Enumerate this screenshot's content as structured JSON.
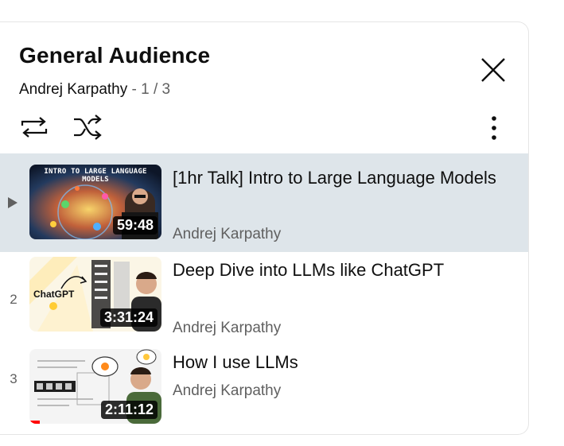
{
  "playlist": {
    "title": "General Audience",
    "owner": "Andrej Karpathy",
    "separator": "-",
    "position": "1 / 3"
  },
  "icons": {
    "close": "close-icon",
    "loop": "loop-icon",
    "shuffle": "shuffle-icon",
    "more": "more-vert-icon",
    "now_playing": "play-arrow-icon"
  },
  "colors": {
    "active_row_bg": "#dee5ea",
    "text_primary": "#0f0f0f",
    "text_secondary": "#606060",
    "progress": "#ff0000"
  },
  "videos": [
    {
      "index": "▶",
      "title": "[1hr Talk] Intro to Large Language Models",
      "channel": "Andrej Karpathy",
      "duration": "59:48",
      "thumb_caption": "INTRO TO LARGE LANGUAGE MODELS",
      "active": true
    },
    {
      "index": "2",
      "title": "Deep Dive into LLMs like ChatGPT",
      "channel": "Andrej Karpathy",
      "duration": "3:31:24",
      "thumb_caption": "ChatGPT"
    },
    {
      "index": "3",
      "title": "How I use LLMs",
      "channel": "Andrej Karpathy",
      "duration": "2:11:12",
      "watched_fraction": 0.08
    }
  ]
}
